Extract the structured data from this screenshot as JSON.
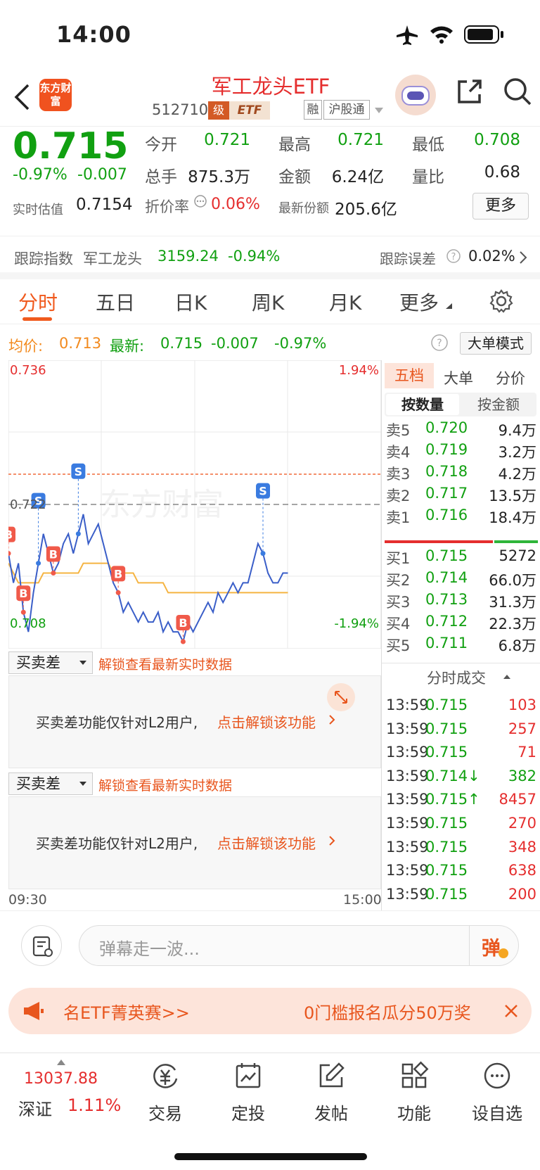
{
  "status_bar": {
    "time": "14:00"
  },
  "header": {
    "logo_text": "东方财富",
    "title": "军工龙头ETF",
    "code": "512710",
    "level_badge": "级",
    "etf_badge": "ETF",
    "tags": [
      "融",
      "沪股通"
    ]
  },
  "quote": {
    "price": "0.715",
    "change_pct": "-0.97%",
    "change": "-0.007",
    "est_label": "实时估值",
    "est_value": "0.7154",
    "fields": [
      {
        "label": "今开",
        "value": "0.721",
        "color": "#11a011"
      },
      {
        "label": "最高",
        "value": "0.721",
        "color": "#11a011"
      },
      {
        "label": "最低",
        "value": "0.708",
        "color": "#11a011"
      },
      {
        "label": "总手",
        "value": "875.3万",
        "color": "#222222"
      },
      {
        "label": "金额",
        "value": "6.24亿",
        "color": "#222222"
      },
      {
        "label": "量比",
        "value": "0.68",
        "color": "#222222"
      }
    ],
    "premium_label": "折价率",
    "premium_value": "0.06%",
    "shares_label": "最新份额",
    "shares_value": "205.6亿",
    "more_button": "更多"
  },
  "tracking": {
    "label": "跟踪指数",
    "index_name": "军工龙头",
    "index_value": "3159.24",
    "index_change": "-0.94%",
    "error_label": "跟踪误差",
    "error_value": "0.02%"
  },
  "tabs": [
    "分时",
    "五日",
    "日K",
    "周K",
    "月K",
    "更多"
  ],
  "chart_header": {
    "avg_label": "均价:",
    "avg_value": "0.713",
    "last_label": "最新:",
    "last_value": "0.715",
    "last_change": "-0.007",
    "last_pct": "-0.97%",
    "big_order_button": "大单模式"
  },
  "chart_data": {
    "type": "line",
    "y_top": "0.736",
    "y_mid": "0.722",
    "y_bottom": "0.708",
    "pct_top": "1.94%",
    "pct_bottom": "-1.94%",
    "ylim": [
      0.708,
      0.736
    ],
    "prev_close": 0.722,
    "watermark": "东方财富",
    "x_start": "09:30",
    "x_end": "15:00",
    "series": [
      {
        "name": "价格",
        "values": [
          0.717,
          0.714,
          0.716,
          0.711,
          0.709,
          0.713,
          0.716,
          0.719,
          0.717,
          0.715,
          0.716,
          0.718,
          0.719,
          0.717,
          0.719,
          0.721,
          0.718,
          0.719,
          0.72,
          0.718,
          0.716,
          0.714,
          0.713,
          0.711,
          0.712,
          0.711,
          0.71,
          0.711,
          0.71,
          0.71,
          0.711,
          0.709,
          0.71,
          0.709,
          0.709,
          0.708,
          0.71,
          0.709,
          0.71,
          0.711,
          0.712,
          0.711,
          0.713,
          0.712,
          0.713,
          0.714,
          0.713,
          0.714,
          0.714,
          0.716,
          0.718,
          0.717,
          0.715,
          0.714,
          0.714,
          0.715,
          0.715
        ]
      },
      {
        "name": "均价",
        "values": [
          0.716,
          0.715,
          0.714,
          0.714,
          0.714,
          0.714,
          0.714,
          0.715,
          0.715,
          0.715,
          0.715,
          0.715,
          0.715,
          0.715,
          0.715,
          0.716,
          0.716,
          0.716,
          0.716,
          0.716,
          0.716,
          0.715,
          0.715,
          0.715,
          0.715,
          0.715,
          0.714,
          0.714,
          0.714,
          0.714,
          0.714,
          0.714,
          0.713,
          0.713,
          0.713,
          0.713,
          0.713,
          0.713,
          0.713,
          0.713,
          0.713,
          0.713,
          0.713,
          0.713,
          0.713,
          0.713,
          0.713,
          0.713,
          0.713,
          0.713,
          0.713,
          0.713,
          0.713,
          0.713,
          0.713,
          0.713,
          0.713
        ]
      }
    ],
    "markers": [
      {
        "label": "B",
        "index": 0
      },
      {
        "label": "B",
        "index": 3
      },
      {
        "label": "S",
        "index": 6
      },
      {
        "label": "B",
        "index": 9
      },
      {
        "label": "S",
        "index": 14
      },
      {
        "label": "B",
        "index": 22
      },
      {
        "label": "B",
        "index": 35
      },
      {
        "label": "S",
        "index": 51
      }
    ]
  },
  "orderbook": {
    "tabs": [
      "五档",
      "大单",
      "分价"
    ],
    "subtabs": [
      "按数量",
      "按金额"
    ],
    "asks": [
      {
        "label": "卖5",
        "price": "0.720",
        "vol": "9.4万"
      },
      {
        "label": "卖4",
        "price": "0.719",
        "vol": "3.2万"
      },
      {
        "label": "卖3",
        "price": "0.718",
        "vol": "4.2万"
      },
      {
        "label": "卖2",
        "price": "0.717",
        "vol": "13.5万"
      },
      {
        "label": "卖1",
        "price": "0.716",
        "vol": "18.4万"
      }
    ],
    "bids": [
      {
        "label": "买1",
        "price": "0.715",
        "vol": "5272"
      },
      {
        "label": "买2",
        "price": "0.714",
        "vol": "66.0万"
      },
      {
        "label": "买3",
        "price": "0.713",
        "vol": "31.3万"
      },
      {
        "label": "买4",
        "price": "0.712",
        "vol": "22.3万"
      },
      {
        "label": "买5",
        "price": "0.711",
        "vol": "6.8万"
      }
    ],
    "trades_title": "分时成交",
    "trades": [
      {
        "time": "13:59",
        "price": "0.715",
        "vol": "103"
      },
      {
        "time": "13:59",
        "price": "0.715",
        "vol": "257"
      },
      {
        "time": "13:59",
        "price": "0.715",
        "vol": "71"
      },
      {
        "time": "13:59",
        "price": "0.714↓",
        "vol": "382"
      },
      {
        "time": "13:59",
        "price": "0.715↑",
        "vol": "8457"
      },
      {
        "time": "13:59",
        "price": "0.715",
        "vol": "270"
      },
      {
        "time": "13:59",
        "price": "0.715",
        "vol": "348"
      },
      {
        "time": "13:59",
        "price": "0.715",
        "vol": "638"
      },
      {
        "time": "13:59",
        "price": "0.715",
        "vol": "200"
      }
    ]
  },
  "sub_panels": [
    {
      "selector": "买卖差",
      "notice": "解锁查看最新实时数据",
      "body": "买卖差功能仅针对L2用户,",
      "link": "点击解锁该功能"
    },
    {
      "selector": "买卖差",
      "notice": "解锁查看最新实时数据",
      "body": "买卖差功能仅针对L2用户,",
      "link": "点击解锁该功能"
    }
  ],
  "danmu": {
    "placeholder": "弹幕走一波...",
    "button": "弹"
  },
  "banner": {
    "left_text": "名ETF菁英赛>>",
    "right_text": "0门槛报名瓜分50万奖"
  },
  "bottom_bar": {
    "index_value": "13037.88",
    "index_name": "深证",
    "index_change": "1.11%",
    "items": [
      "交易",
      "定投",
      "发帖",
      "功能",
      "设自选"
    ]
  }
}
